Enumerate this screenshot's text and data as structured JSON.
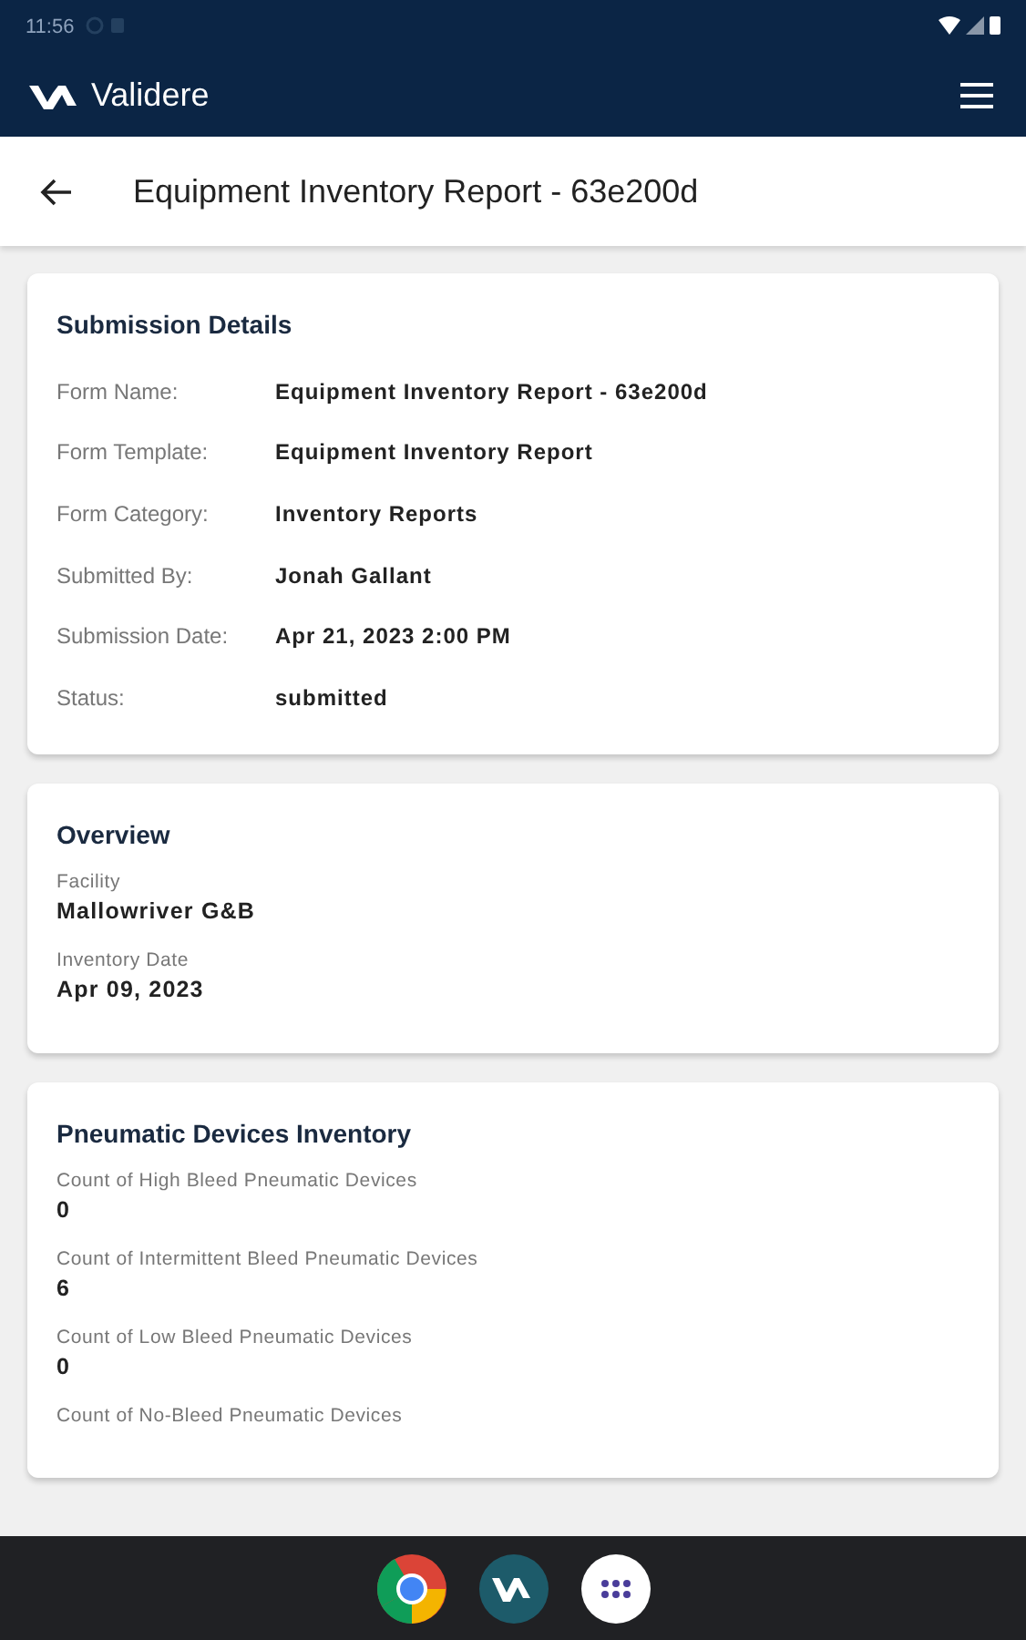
{
  "status_bar": {
    "time": "11:56"
  },
  "app_bar": {
    "title": "Validere"
  },
  "page_header": {
    "title": "Equipment Inventory Report - 63e200d"
  },
  "cards": [
    {
      "kind": "table",
      "title": "Submission Details",
      "fields": [
        {
          "label": "Form Name:",
          "value": "Equipment Inventory Report - 63e200d"
        },
        {
          "label": "Form Template:",
          "value": "Equipment Inventory Report"
        },
        {
          "label": "Form Category:",
          "value": "Inventory Reports"
        },
        {
          "label": "Submitted By:",
          "value": "Jonah Gallant"
        },
        {
          "label": "Submission Date:",
          "value": "Apr 21, 2023 2:00 PM"
        },
        {
          "label": "Status:",
          "value": "submitted"
        }
      ]
    },
    {
      "kind": "stacked",
      "title": "Overview",
      "fields": [
        {
          "label": "Facility",
          "value": "Mallowriver G&B"
        },
        {
          "label": "Inventory Date",
          "value": "Apr 09, 2023"
        }
      ]
    },
    {
      "kind": "stacked",
      "title": "Pneumatic Devices Inventory",
      "fields": [
        {
          "label": "Count of High Bleed Pneumatic Devices",
          "value": "0"
        },
        {
          "label": "Count of Intermittent Bleed Pneumatic Devices",
          "value": "6"
        },
        {
          "label": "Count of Low Bleed Pneumatic Devices",
          "value": "0"
        },
        {
          "label": "Count of No-Bleed Pneumatic Devices"
        }
      ]
    }
  ]
}
